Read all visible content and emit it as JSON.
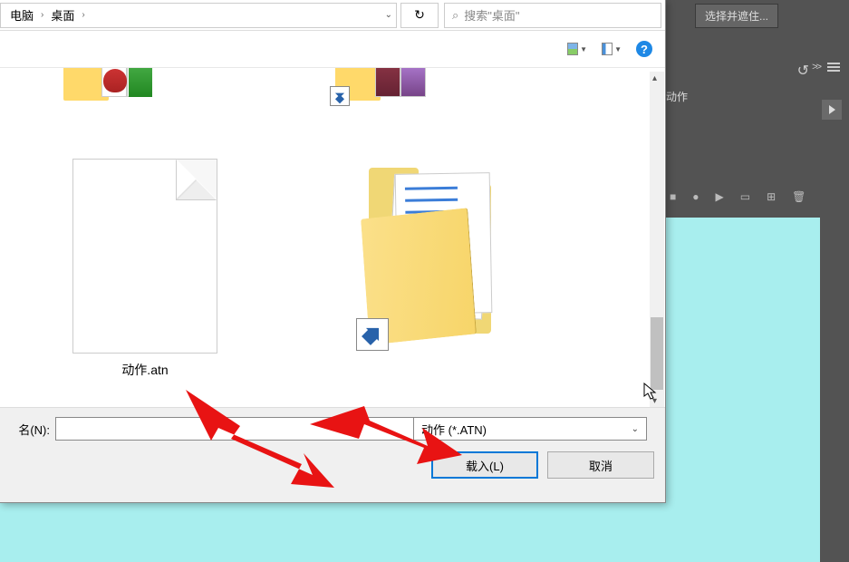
{
  "ps": {
    "select_mask": "选择并遮住...",
    "actions_label": "动作"
  },
  "dialog": {
    "breadcrumb": {
      "item1": "电脑",
      "item2": "桌面"
    },
    "search_placeholder": "搜索\"桌面\"",
    "file_label": "动作.atn",
    "filename_label": "名(N):",
    "filename_value": "",
    "filetype": "动作 (*.ATN)",
    "load_btn": "载入(L)",
    "cancel_btn": "取消"
  }
}
